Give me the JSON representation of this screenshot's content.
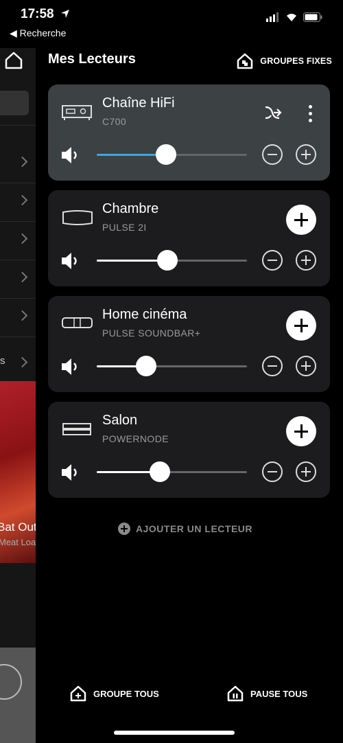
{
  "status": {
    "time": "17:58",
    "back_label": "◀ Recherche"
  },
  "header": {
    "title": "Mes Lecteurs",
    "groups_label": "GROUPES FIXES"
  },
  "peek": {
    "partial_text": "s",
    "album_title": "Bat Out",
    "album_artist": "Meat Loa"
  },
  "players": [
    {
      "name": "Chaîne HiFi",
      "model": "C700",
      "volume": 0.46,
      "active": true
    },
    {
      "name": "Chambre",
      "model": "PULSE 2I",
      "volume": 0.47,
      "active": false
    },
    {
      "name": "Home cinéma",
      "model": "PULSE SOUNDBAR+",
      "volume": 0.33,
      "active": false
    },
    {
      "name": "Salon",
      "model": "POWERNODE",
      "volume": 0.42,
      "active": false
    }
  ],
  "add_player_label": "AJOUTER UN LECTEUR",
  "footer": {
    "group_all": "GROUPE TOUS",
    "pause_all": "PAUSE TOUS"
  },
  "colors": {
    "active_card": "#3c4144",
    "card": "#1c1c1e",
    "accent": "#3ba7e0"
  }
}
